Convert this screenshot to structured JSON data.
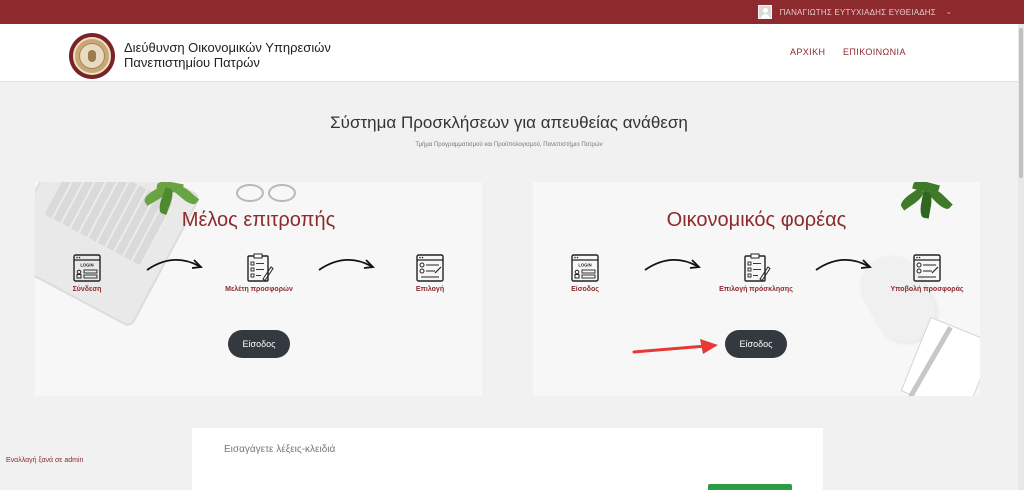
{
  "topbar": {
    "user_name": "ΠΑΝΑΓΙΩΤΗΣ ΕΥΤΥΧΙΑΔΗΣ ΕΥΘΕΙΑΔΗΣ"
  },
  "header": {
    "brand_line1": "Διεύθυνση Οικονομικών Υπηρεσιών",
    "brand_line2": "Πανεπιστημίου Πατρών",
    "nav": {
      "home": "ΑΡΧΙΚΗ",
      "contact": "ΕΠΙΚΟΙΝΩΝΙΑ"
    }
  },
  "page": {
    "title": "Σύστημα Προσκλήσεων για απευθείας ανάθεση",
    "subtitle": "Τμήμα Προγραμματισμού και Προϋπολογισμού, Πανεπιστήμιο Πατρών"
  },
  "cards": {
    "committee": {
      "title": "Μέλος επιτροπής",
      "steps": [
        "Σύνδεση",
        "Μελέτη προσφορών",
        "Επιλογή"
      ],
      "button": "Είσοδος"
    },
    "provider": {
      "title": "Οικονομικός φορέας",
      "steps": [
        "Είσοδος",
        "Επιλογή πρόσκλησης",
        "Υποβολή προσφοράς"
      ],
      "button": "Είσοδος"
    }
  },
  "icons": {
    "login_caption": "LOGIN"
  },
  "switch_admin": "Εναλλαγή ξανά σε admin",
  "search": {
    "placeholder": "Εισαγάγετε λέξεις-κλειδιά"
  },
  "colors": {
    "brand": "#8c2a2e",
    "button_dark": "#34393f",
    "accent_green": "#2a9d45",
    "annotation_arrow": "#e53935"
  }
}
